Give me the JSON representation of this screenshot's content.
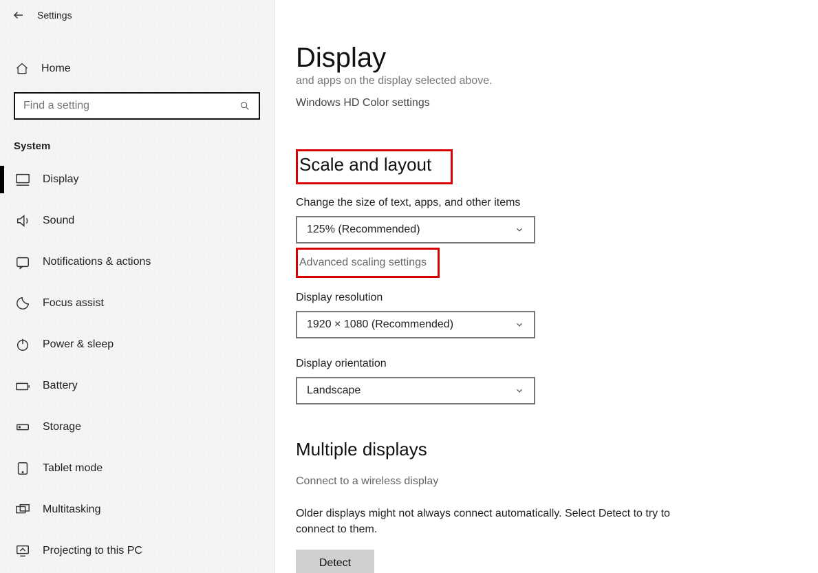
{
  "app": {
    "title": "Settings"
  },
  "sidebar": {
    "home_label": "Home",
    "search_placeholder": "Find a setting",
    "section_label": "System",
    "items": [
      {
        "label": "Display"
      },
      {
        "label": "Sound"
      },
      {
        "label": "Notifications & actions"
      },
      {
        "label": "Focus assist"
      },
      {
        "label": "Power & sleep"
      },
      {
        "label": "Battery"
      },
      {
        "label": "Storage"
      },
      {
        "label": "Tablet mode"
      },
      {
        "label": "Multitasking"
      },
      {
        "label": "Projecting to this PC"
      }
    ]
  },
  "main": {
    "page_title": "Display",
    "partial_caption": "and apps on the display selected above.",
    "hd_color_link": "Windows HD Color settings",
    "scale_section_title": "Scale and layout",
    "scale_label": "Change the size of text, apps, and other items",
    "scale_value": "125% (Recommended)",
    "advanced_scaling_link": "Advanced scaling settings",
    "resolution_label": "Display resolution",
    "resolution_value": "1920 × 1080 (Recommended)",
    "orientation_label": "Display orientation",
    "orientation_value": "Landscape",
    "multiple_title": "Multiple displays",
    "wireless_link": "Connect to a wireless display",
    "multiple_body": "Older displays might not always connect automatically. Select Detect to try to connect to them.",
    "detect_label": "Detect"
  }
}
